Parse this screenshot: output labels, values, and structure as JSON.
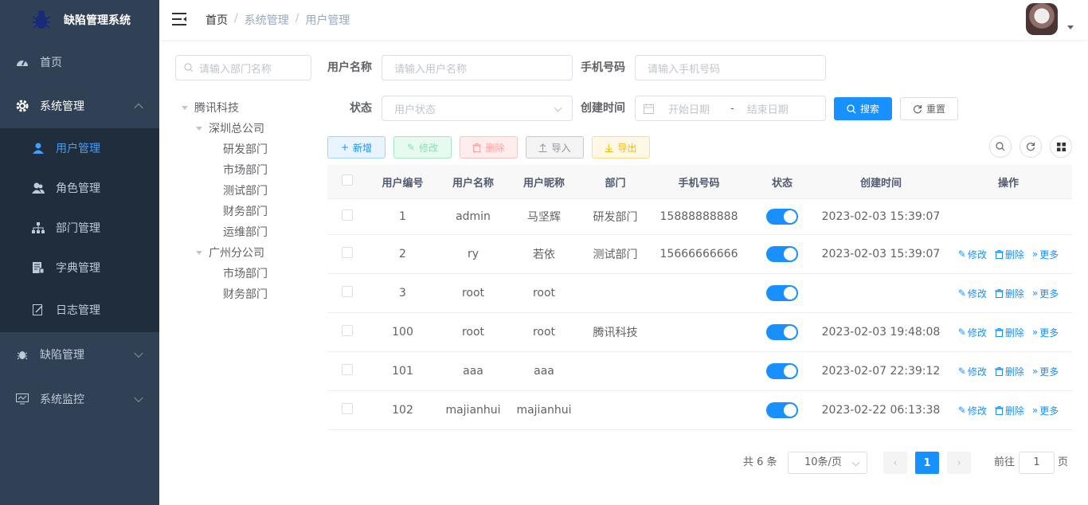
{
  "app": {
    "title": "缺陷管理系统"
  },
  "sidebar": {
    "items": [
      {
        "label": "首页",
        "icon": "dashboard-icon"
      },
      {
        "label": "系统管理",
        "icon": "gear-icon"
      },
      {
        "label": "用户管理",
        "icon": "user-icon"
      },
      {
        "label": "角色管理",
        "icon": "peoples-icon"
      },
      {
        "label": "部门管理",
        "icon": "tree-icon"
      },
      {
        "label": "字典管理",
        "icon": "dict-icon"
      },
      {
        "label": "日志管理",
        "icon": "log-icon"
      },
      {
        "label": "缺陷管理",
        "icon": "bug-icon"
      },
      {
        "label": "系统监控",
        "icon": "monitor-icon"
      }
    ]
  },
  "breadcrumb": [
    "首页",
    "系统管理",
    "用户管理"
  ],
  "dept_tree": {
    "placeholder": "请输入部门名称",
    "nodes": [
      "腾讯科技",
      "深圳总公司",
      "研发部门",
      "市场部门",
      "测试部门",
      "财务部门",
      "运维部门",
      "广州分公司",
      "市场部门",
      "财务部门"
    ]
  },
  "query": {
    "username_label": "用户名称",
    "username_placeholder": "请输入用户名称",
    "phone_label": "手机号码",
    "phone_placeholder": "请输入手机号码",
    "status_label": "状态",
    "status_placeholder": "用户状态",
    "created_label": "创建时间",
    "start_placeholder": "开始日期",
    "range_sep": "-",
    "end_placeholder": "结束日期",
    "search_label": "搜索",
    "reset_label": "重置"
  },
  "toolbar": {
    "add_label": "新增",
    "edit_label": "修改",
    "delete_label": "删除",
    "import_label": "导入",
    "export_label": "导出"
  },
  "table": {
    "headers": [
      "用户编号",
      "用户名称",
      "用户昵称",
      "部门",
      "手机号码",
      "状态",
      "创建时间",
      "操作"
    ],
    "rows": [
      {
        "id": "1",
        "username": "admin",
        "nickname": "马坚辉",
        "dept": "研发部门",
        "phone": "15888888888",
        "created": "2023-02-03 15:39:07",
        "ops": false
      },
      {
        "id": "2",
        "username": "ry",
        "nickname": "若依",
        "dept": "测试部门",
        "phone": "15666666666",
        "created": "2023-02-03 15:39:07",
        "ops": true
      },
      {
        "id": "3",
        "username": "root",
        "nickname": "root",
        "dept": "",
        "phone": "",
        "created": "",
        "ops": true
      },
      {
        "id": "100",
        "username": "root",
        "nickname": "root",
        "dept": "腾讯科技",
        "phone": "",
        "created": "2023-02-03 19:48:08",
        "ops": true
      },
      {
        "id": "101",
        "username": "aaa",
        "nickname": "aaa",
        "dept": "",
        "phone": "",
        "created": "2023-02-07 22:39:12",
        "ops": true
      },
      {
        "id": "102",
        "username": "majianhui",
        "nickname": "majianhui",
        "dept": "",
        "phone": "",
        "created": "2023-02-22 06:13:38",
        "ops": true
      }
    ],
    "op_edit": "修改",
    "op_delete": "删除",
    "op_more": "更多"
  },
  "pagination": {
    "total": "共 6 条",
    "page_size": "10条/页",
    "current": "1",
    "goto_label": "前往",
    "goto_value": "1",
    "page_label": "页"
  },
  "colors": {
    "sidebar_bg": "#304156",
    "submenu_bg": "#1f2d3d",
    "accent": "#1890ff"
  }
}
